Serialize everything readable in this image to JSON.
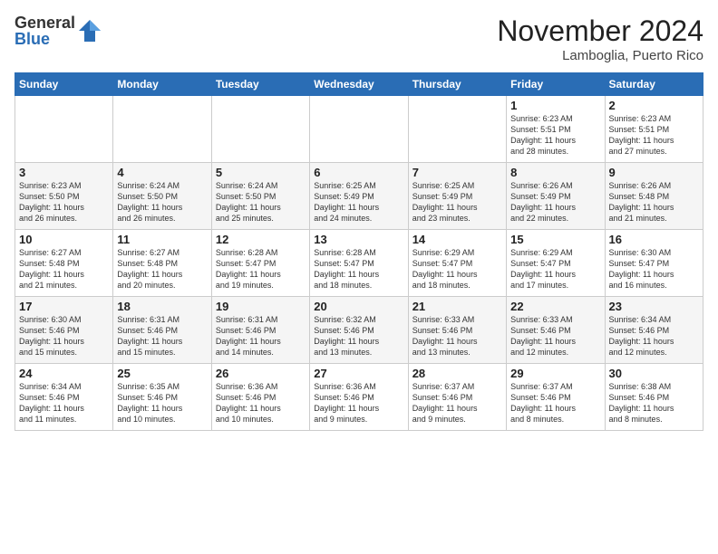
{
  "logo": {
    "general": "General",
    "blue": "Blue"
  },
  "title": "November 2024",
  "location": "Lamboglia, Puerto Rico",
  "days_of_week": [
    "Sunday",
    "Monday",
    "Tuesday",
    "Wednesday",
    "Thursday",
    "Friday",
    "Saturday"
  ],
  "weeks": [
    [
      {
        "day": "",
        "info": ""
      },
      {
        "day": "",
        "info": ""
      },
      {
        "day": "",
        "info": ""
      },
      {
        "day": "",
        "info": ""
      },
      {
        "day": "",
        "info": ""
      },
      {
        "day": "1",
        "info": "Sunrise: 6:23 AM\nSunset: 5:51 PM\nDaylight: 11 hours\nand 28 minutes."
      },
      {
        "day": "2",
        "info": "Sunrise: 6:23 AM\nSunset: 5:51 PM\nDaylight: 11 hours\nand 27 minutes."
      }
    ],
    [
      {
        "day": "3",
        "info": "Sunrise: 6:23 AM\nSunset: 5:50 PM\nDaylight: 11 hours\nand 26 minutes."
      },
      {
        "day": "4",
        "info": "Sunrise: 6:24 AM\nSunset: 5:50 PM\nDaylight: 11 hours\nand 26 minutes."
      },
      {
        "day": "5",
        "info": "Sunrise: 6:24 AM\nSunset: 5:50 PM\nDaylight: 11 hours\nand 25 minutes."
      },
      {
        "day": "6",
        "info": "Sunrise: 6:25 AM\nSunset: 5:49 PM\nDaylight: 11 hours\nand 24 minutes."
      },
      {
        "day": "7",
        "info": "Sunrise: 6:25 AM\nSunset: 5:49 PM\nDaylight: 11 hours\nand 23 minutes."
      },
      {
        "day": "8",
        "info": "Sunrise: 6:26 AM\nSunset: 5:49 PM\nDaylight: 11 hours\nand 22 minutes."
      },
      {
        "day": "9",
        "info": "Sunrise: 6:26 AM\nSunset: 5:48 PM\nDaylight: 11 hours\nand 21 minutes."
      }
    ],
    [
      {
        "day": "10",
        "info": "Sunrise: 6:27 AM\nSunset: 5:48 PM\nDaylight: 11 hours\nand 21 minutes."
      },
      {
        "day": "11",
        "info": "Sunrise: 6:27 AM\nSunset: 5:48 PM\nDaylight: 11 hours\nand 20 minutes."
      },
      {
        "day": "12",
        "info": "Sunrise: 6:28 AM\nSunset: 5:47 PM\nDaylight: 11 hours\nand 19 minutes."
      },
      {
        "day": "13",
        "info": "Sunrise: 6:28 AM\nSunset: 5:47 PM\nDaylight: 11 hours\nand 18 minutes."
      },
      {
        "day": "14",
        "info": "Sunrise: 6:29 AM\nSunset: 5:47 PM\nDaylight: 11 hours\nand 18 minutes."
      },
      {
        "day": "15",
        "info": "Sunrise: 6:29 AM\nSunset: 5:47 PM\nDaylight: 11 hours\nand 17 minutes."
      },
      {
        "day": "16",
        "info": "Sunrise: 6:30 AM\nSunset: 5:47 PM\nDaylight: 11 hours\nand 16 minutes."
      }
    ],
    [
      {
        "day": "17",
        "info": "Sunrise: 6:30 AM\nSunset: 5:46 PM\nDaylight: 11 hours\nand 15 minutes."
      },
      {
        "day": "18",
        "info": "Sunrise: 6:31 AM\nSunset: 5:46 PM\nDaylight: 11 hours\nand 15 minutes."
      },
      {
        "day": "19",
        "info": "Sunrise: 6:31 AM\nSunset: 5:46 PM\nDaylight: 11 hours\nand 14 minutes."
      },
      {
        "day": "20",
        "info": "Sunrise: 6:32 AM\nSunset: 5:46 PM\nDaylight: 11 hours\nand 13 minutes."
      },
      {
        "day": "21",
        "info": "Sunrise: 6:33 AM\nSunset: 5:46 PM\nDaylight: 11 hours\nand 13 minutes."
      },
      {
        "day": "22",
        "info": "Sunrise: 6:33 AM\nSunset: 5:46 PM\nDaylight: 11 hours\nand 12 minutes."
      },
      {
        "day": "23",
        "info": "Sunrise: 6:34 AM\nSunset: 5:46 PM\nDaylight: 11 hours\nand 12 minutes."
      }
    ],
    [
      {
        "day": "24",
        "info": "Sunrise: 6:34 AM\nSunset: 5:46 PM\nDaylight: 11 hours\nand 11 minutes."
      },
      {
        "day": "25",
        "info": "Sunrise: 6:35 AM\nSunset: 5:46 PM\nDaylight: 11 hours\nand 10 minutes."
      },
      {
        "day": "26",
        "info": "Sunrise: 6:36 AM\nSunset: 5:46 PM\nDaylight: 11 hours\nand 10 minutes."
      },
      {
        "day": "27",
        "info": "Sunrise: 6:36 AM\nSunset: 5:46 PM\nDaylight: 11 hours\nand 9 minutes."
      },
      {
        "day": "28",
        "info": "Sunrise: 6:37 AM\nSunset: 5:46 PM\nDaylight: 11 hours\nand 9 minutes."
      },
      {
        "day": "29",
        "info": "Sunrise: 6:37 AM\nSunset: 5:46 PM\nDaylight: 11 hours\nand 8 minutes."
      },
      {
        "day": "30",
        "info": "Sunrise: 6:38 AM\nSunset: 5:46 PM\nDaylight: 11 hours\nand 8 minutes."
      }
    ]
  ]
}
